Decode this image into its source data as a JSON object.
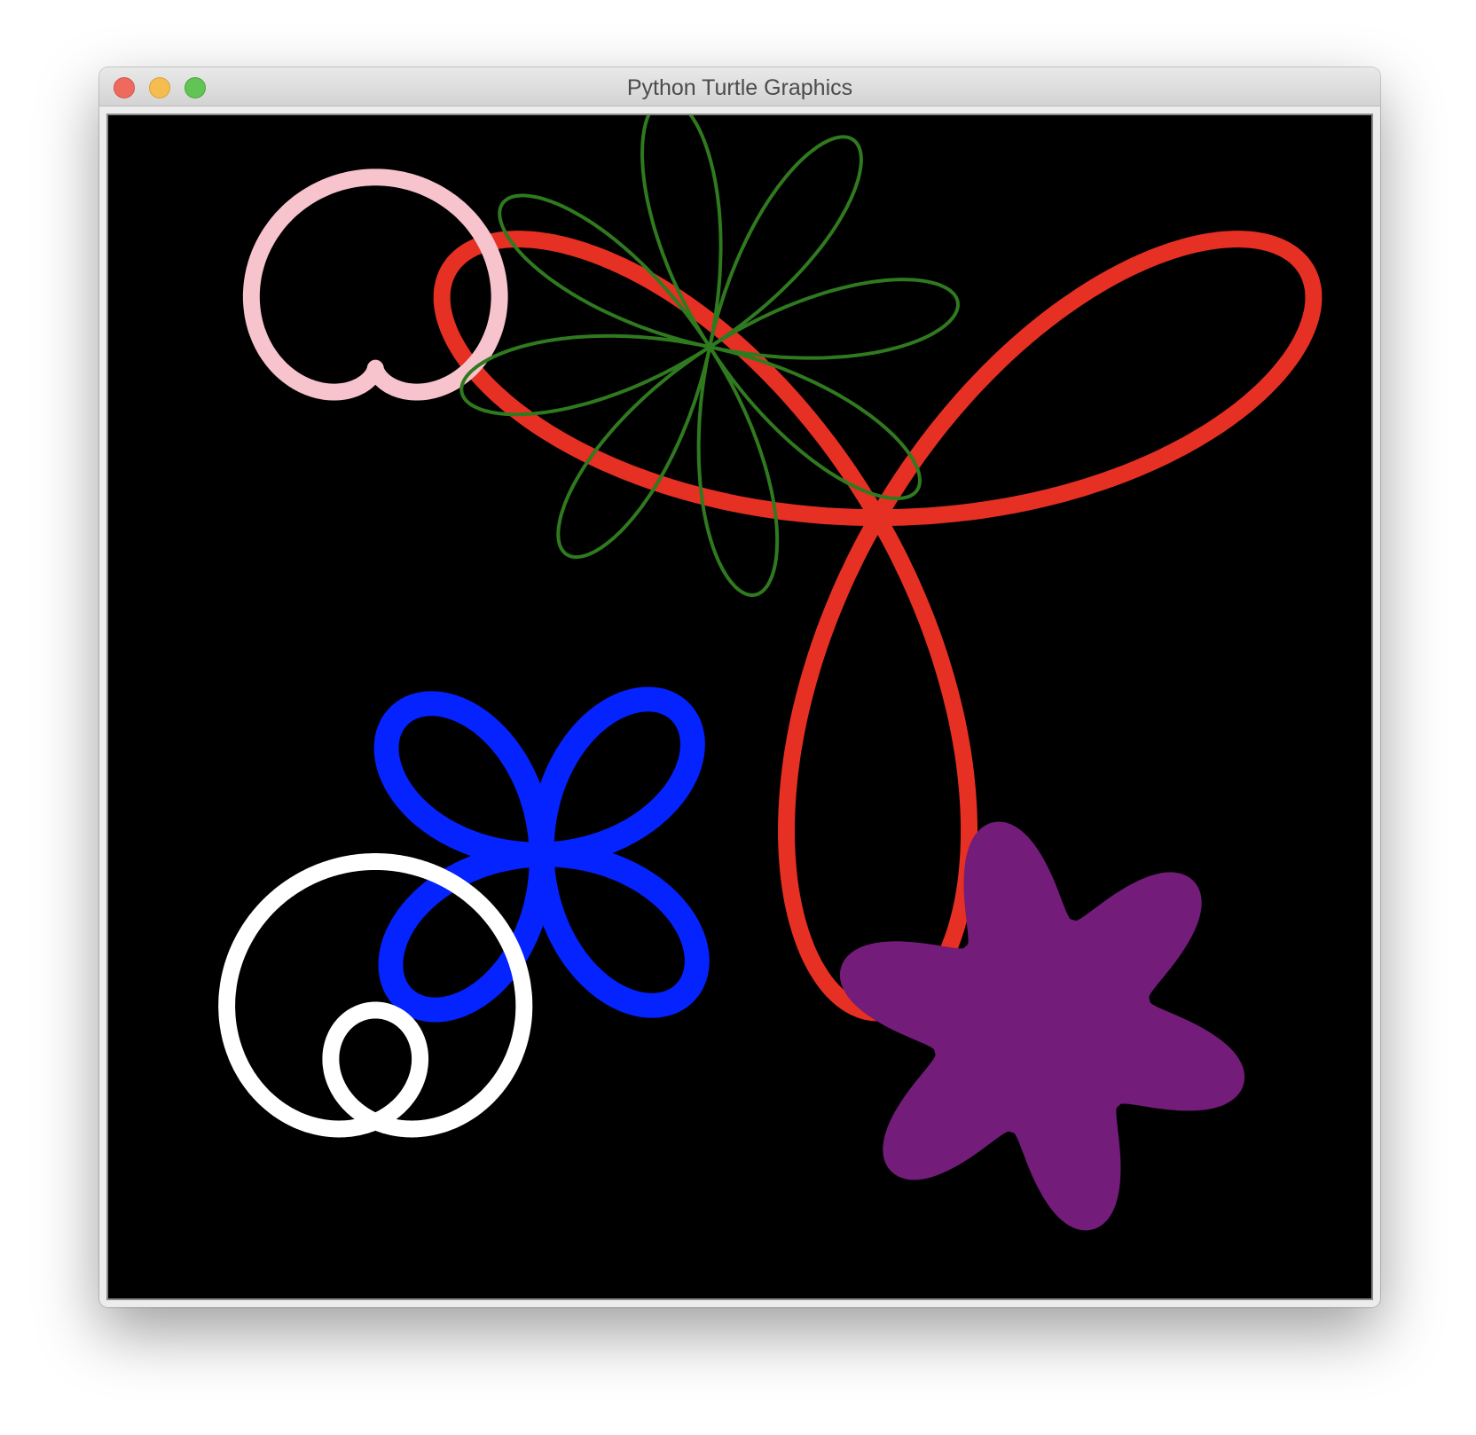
{
  "window": {
    "title": "Python Turtle Graphics",
    "controls": [
      "close-button",
      "minimize-button",
      "zoom-button"
    ]
  },
  "canvas": {
    "background": "#000000"
  },
  "drawings": [
    {
      "name": "pink-cardioid",
      "color": "#f7c3cd"
    },
    {
      "name": "red-trefoil",
      "color": "#e63023"
    },
    {
      "name": "green-eight-petal-rose",
      "color": "#2f7a1f"
    },
    {
      "name": "blue-four-leaf-clover",
      "color": "#0423ff"
    },
    {
      "name": "white-limacon",
      "color": "#ffffff"
    },
    {
      "name": "purple-filled-star",
      "color": "#731c7a"
    }
  ]
}
